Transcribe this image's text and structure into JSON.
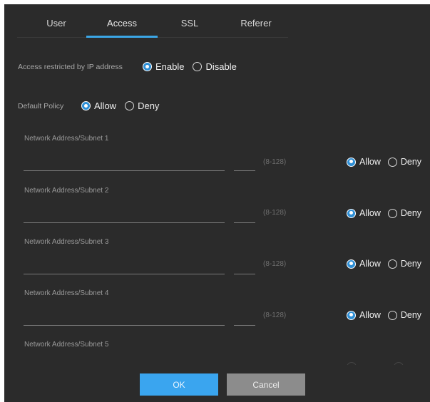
{
  "tabs": [
    "User",
    "Access",
    "SSL",
    "Referer"
  ],
  "active_tab": "Access",
  "access_restricted": {
    "label": "Access restricted by IP address",
    "options": [
      "Enable",
      "Disable"
    ],
    "selected": "Enable"
  },
  "default_policy": {
    "label": "Default Policy",
    "options": [
      "Allow",
      "Deny"
    ],
    "selected": "Allow"
  },
  "subnets": [
    {
      "label": "Network Address/Subnet 1",
      "range": "(8-128)",
      "allow": "Allow",
      "deny": "Deny",
      "selected": "Allow"
    },
    {
      "label": "Network Address/Subnet 2",
      "range": "(8-128)",
      "allow": "Allow",
      "deny": "Deny",
      "selected": "Allow"
    },
    {
      "label": "Network Address/Subnet 3",
      "range": "(8-128)",
      "allow": "Allow",
      "deny": "Deny",
      "selected": "Allow"
    },
    {
      "label": "Network Address/Subnet 4",
      "range": "(8-128)",
      "allow": "Allow",
      "deny": "Deny",
      "selected": "Allow"
    },
    {
      "label": "Network Address/Subnet 5"
    }
  ],
  "buttons": {
    "ok": "OK",
    "cancel": "Cancel"
  },
  "colors": {
    "accent": "#3ba6e6",
    "background": "#2b2b2b",
    "ok_button": "#3aa5ef",
    "cancel_button": "#8c8c8c"
  }
}
